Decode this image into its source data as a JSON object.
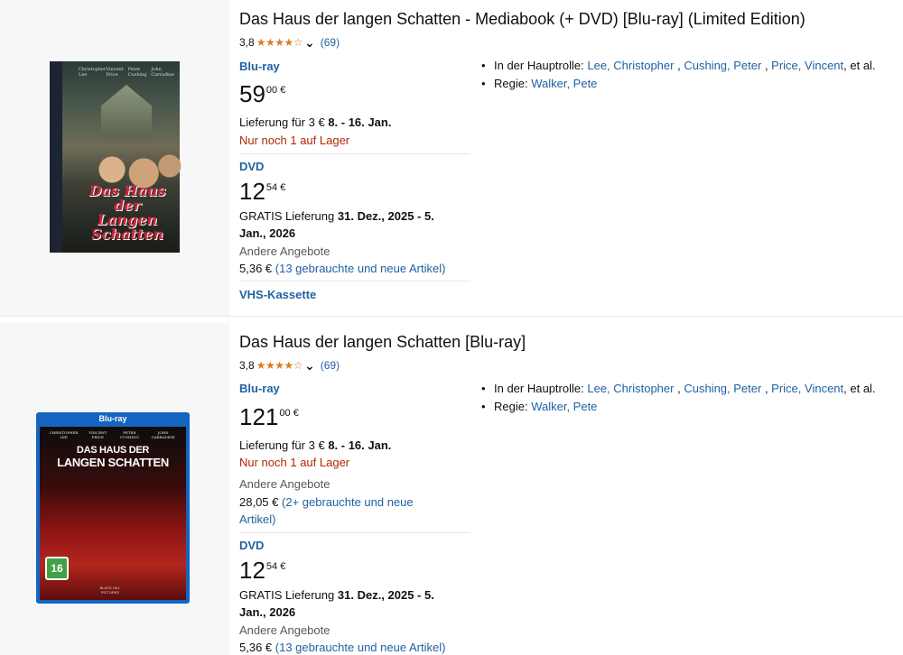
{
  "results": [
    {
      "title": "Das Haus der langen Schatten - Mediabook (+ DVD) [Blu-ray] (Limited Edition)",
      "rating_value": "3,8",
      "rating_stars": 3.8,
      "rating_count": "(69)",
      "formats": [
        {
          "label": "Blu-ray",
          "price_whole": "59",
          "price_fraction": "00",
          "currency": "€",
          "delivery_prefix": "Lieferung für 3 €",
          "delivery_date": "8. - 16. Jan.",
          "stock": "Nur noch 1 auf Lager"
        },
        {
          "label": "DVD",
          "price_whole": "12",
          "price_fraction": "54",
          "currency": "€",
          "delivery_prefix": "GRATIS Lieferung",
          "delivery_date_line1": "31. Dez., 2025 - 5.",
          "delivery_date_line2": "Jan., 2026",
          "other_offers": "Andere Angebote",
          "offers_price": "5,36 €",
          "offers_link": "(13 gebrauchte und neue Artikel)"
        },
        {
          "label": "VHS-Kassette"
        }
      ],
      "credits": {
        "starring_label": "In der Hauptrolle:",
        "actors": [
          "Lee, Christopher",
          "Cushing, Peter",
          "Price, Vincent"
        ],
        "etal": ", et al.",
        "director_label": "Regie:",
        "director": "Walker, Pete"
      },
      "cover": {
        "names": [
          "Christopher Lee",
          "Vincent Price",
          "Peter Cushing",
          "John Carradine"
        ],
        "title_line1": "Das Haus der",
        "title_line2": "Langen Schatten"
      }
    },
    {
      "title": "Das Haus der langen Schatten [Blu-ray]",
      "rating_value": "3,8",
      "rating_stars": 3.8,
      "rating_count": "(69)",
      "formats": [
        {
          "label": "Blu-ray",
          "price_whole": "121",
          "price_fraction": "00",
          "currency": "€",
          "delivery_prefix": "Lieferung für 3 €",
          "delivery_date": "8. - 16. Jan.",
          "stock": "Nur noch 1 auf Lager",
          "other_offers": "Andere Angebote",
          "offers_price": "28,05 €",
          "offers_link_line1": "(2+ gebrauchte und neue",
          "offers_link_line2": "Artikel)"
        },
        {
          "label": "DVD",
          "price_whole": "12",
          "price_fraction": "54",
          "currency": "€",
          "delivery_prefix": "GRATIS Lieferung",
          "delivery_date_line1": "31. Dez., 2025 - 5.",
          "delivery_date_line2": "Jan., 2026",
          "other_offers": "Andere Angebote",
          "offers_price": "5,36 €",
          "offers_link": "(13 gebrauchte und neue Artikel)"
        }
      ],
      "credits": {
        "starring_label": "In der Hauptrolle:",
        "actors": [
          "Lee, Christopher",
          "Cushing, Peter",
          "Price, Vincent"
        ],
        "etal": ", et al.",
        "director_label": "Regie:",
        "director": "Walker, Pete"
      },
      "cover": {
        "brand": "Blu-ray",
        "names": [
          "CHRISTOPHER LEE",
          "VINCENT PRICE",
          "PETER CUSHING",
          "JOHN CARRADINE"
        ],
        "title_small": "DAS HAUS DER",
        "title_big": "LANGEN SCHATTEN",
        "fsk": "16",
        "label": "BLACK HILL PICTURES"
      }
    }
  ],
  "colors": {
    "link": "#2162a1",
    "price_red": "#b12704",
    "star": "#de7921",
    "thumb_bg": "#f7f7f7"
  }
}
